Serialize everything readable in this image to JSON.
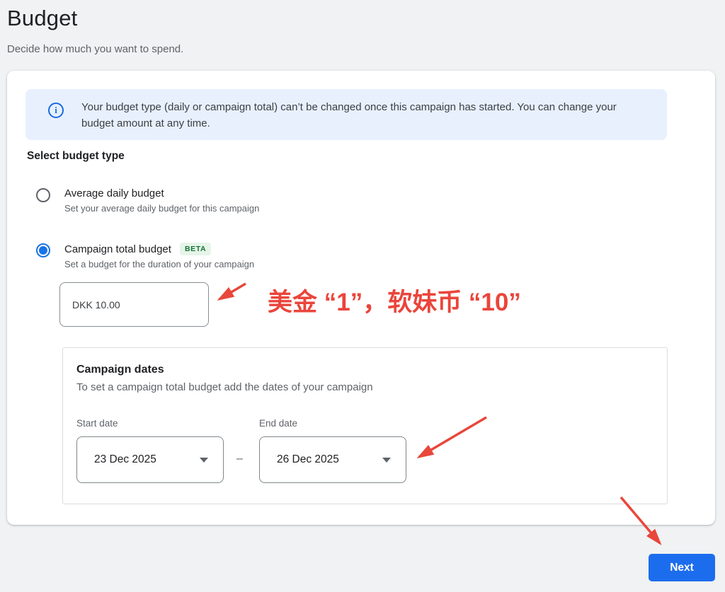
{
  "page": {
    "title": "Budget",
    "subtitle": "Decide how much you want to spend."
  },
  "card": {
    "info_banner": {
      "icon": "info-circle-icon",
      "icon_glyph": "i",
      "text": "Your budget type (daily or campaign total) can’t be changed once this campaign has started. You can change your budget amount at any time."
    },
    "budget_type": {
      "heading": "Select budget type",
      "options": [
        {
          "label": "Average daily budget",
          "description": "Set your average daily budget for this campaign",
          "selected": false
        },
        {
          "label": "Campaign total budget",
          "badge": "BETA",
          "description": "Set a budget for the duration of your campaign",
          "selected": true
        }
      ]
    },
    "budget_amount": {
      "value": "DKK 10.00"
    },
    "campaign_dates": {
      "heading": "Campaign dates",
      "subtitle": "To set a campaign total budget add the dates of your campaign",
      "start": {
        "label": "Start date",
        "value": "23 Dec 2025"
      },
      "end": {
        "label": "End date",
        "value": "26 Dec 2025"
      },
      "separator": "–"
    }
  },
  "annotations": {
    "budget_note": "美金 “1”，软妹币 “10”"
  },
  "actions": {
    "next": "Next"
  },
  "colors": {
    "accent_blue": "#1a73e8",
    "banner_bg": "#e8f0fe",
    "beta_bg": "#e6f4ea",
    "beta_text": "#137333",
    "annotation_red": "#ea453b",
    "page_bg": "#f0f2f3"
  }
}
